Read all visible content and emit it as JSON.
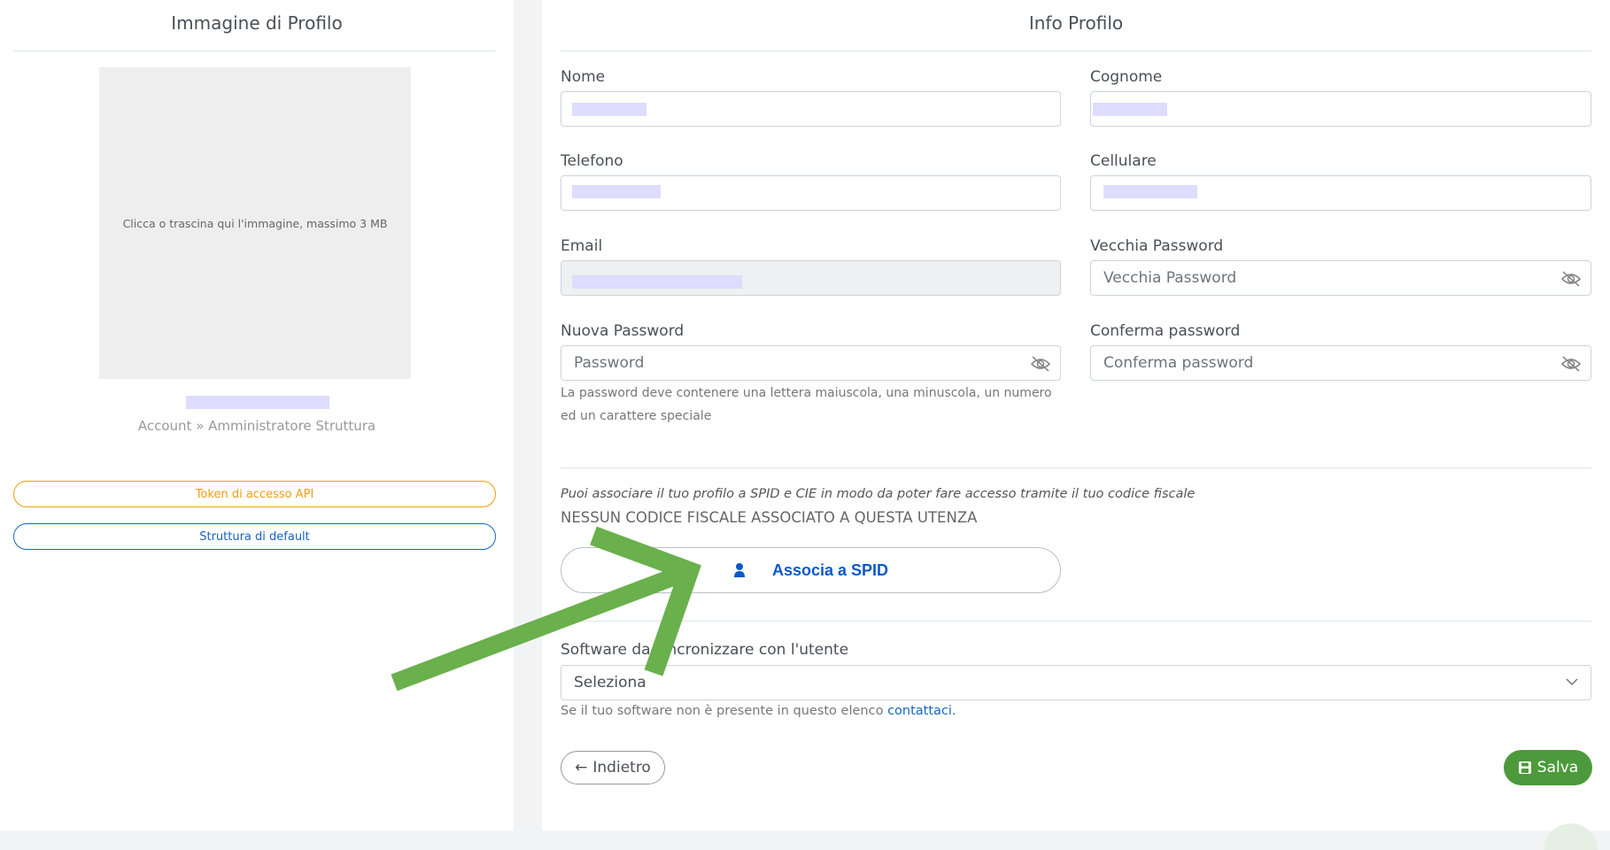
{
  "left": {
    "title": "Immagine di Profilo",
    "dropzone_text": "Clicca o trascina qui l'immagine, massimo 3 MB",
    "role_text": "Account » Amministratore Struttura",
    "token_button": "Token di accesso API",
    "structure_button": "Struttura di default"
  },
  "right": {
    "title": "Info Profilo",
    "fields": {
      "nome_label": "Nome",
      "cognome_label": "Cognome",
      "telefono_label": "Telefono",
      "cellulare_label": "Cellulare",
      "email_label": "Email",
      "old_password_label": "Vecchia Password",
      "old_password_placeholder": "Vecchia Password",
      "new_password_label": "Nuova Password",
      "new_password_placeholder": "Password",
      "confirm_password_label": "Conferma password",
      "confirm_password_placeholder": "Conferma password",
      "password_hint_line1": "La password deve contenere una lettera maiuscola, una minuscola, un numero",
      "password_hint_line2": "ed un carattere speciale"
    },
    "spid": {
      "info": "Puoi associare il tuo profilo a SPID e CIE in modo da poter fare accesso tramite il tuo codice fiscale",
      "status": "NESSUN CODICE FISCALE ASSOCIATO A QUESTA UTENZA",
      "button": "Associa a SPID"
    },
    "software": {
      "label": "Software da sincronizzare con l'utente",
      "selected": "Seleziona",
      "hint": "Se il tuo software non è presente in questo elenco",
      "link": "contattaci."
    },
    "back_button": "Indietro",
    "save_button": "Salva"
  },
  "colors": {
    "accent_green": "#4d9a3c",
    "annotation_arrow": "#6ab04c",
    "spid_blue": "#0b58c8",
    "token_orange": "#f39c12"
  }
}
